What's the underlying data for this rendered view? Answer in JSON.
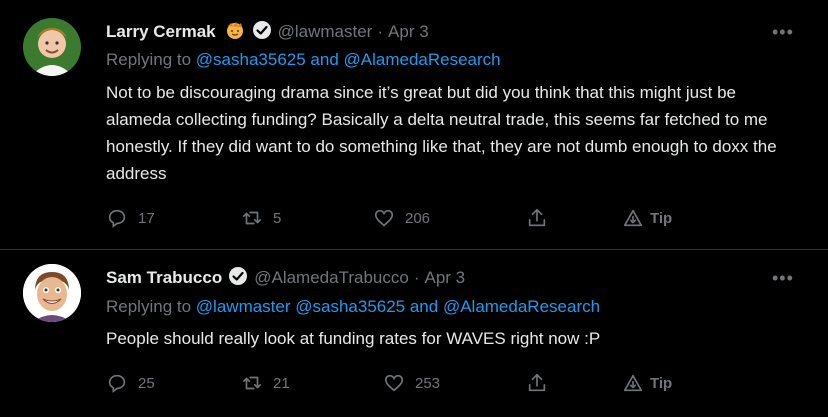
{
  "tweets": [
    {
      "name": "Larry Cermak",
      "handle": "@lawmaster",
      "separator": "·",
      "date": "Apr 3",
      "replying_prefix": "Replying to",
      "replying_mentions": "@sasha35625 and @AlamedaResearch",
      "text": "Not to be discouraging drama since it’s great but did you think that this might just be alameda collecting funding? Basically a delta neutral trade, this seems far fetched to me honestly. If they did want to do something like that, they are not dumb enough to doxx the address",
      "stats": {
        "replies": "17",
        "retweets": "5",
        "likes": "206"
      },
      "tip_label": "Tip",
      "avatar_bg": "#2f6d2a"
    },
    {
      "name": "Sam Trabucco",
      "handle": "@AlamedaTrabucco",
      "separator": "·",
      "date": "Apr 3",
      "replying_prefix": "Replying to",
      "replying_mentions": "@lawmaster @sasha35625 and @AlamedaResearch",
      "text": "People should really look at funding rates for WAVES right now :P",
      "stats": {
        "replies": "25",
        "retweets": "21",
        "likes": "253"
      },
      "tip_label": "Tip",
      "avatar_bg": "#ffffff"
    }
  ],
  "colors": {
    "background": "#000000",
    "text": "#e7e9ea",
    "muted": "#71767b",
    "link": "#1d9bf0",
    "verified": "#e7e9ea",
    "emoji": "#f4b63f"
  },
  "icons": [
    "verified-badge-icon",
    "sun-emoji-icon",
    "more-icon",
    "reply-icon",
    "retweet-icon",
    "like-icon",
    "share-icon",
    "tip-icon"
  ]
}
